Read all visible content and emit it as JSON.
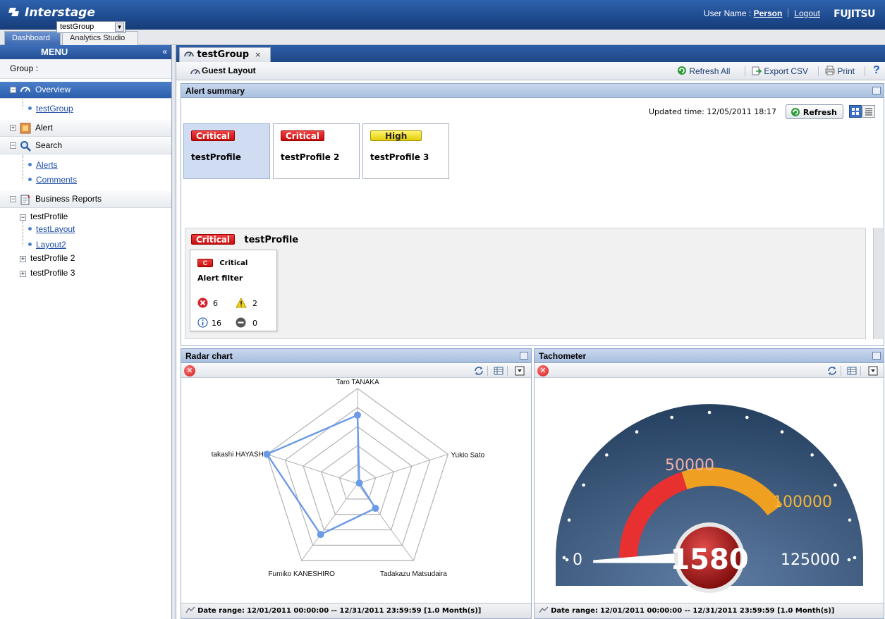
{
  "app": {
    "brand": "Interstage",
    "vendor": "FUJITSU",
    "user_label": "User Name :",
    "user_name": "Person",
    "logout": "Logout"
  },
  "app_tabs": [
    {
      "label": "Dashboard",
      "active": true
    },
    {
      "label": "Analytics Studio",
      "active": false
    }
  ],
  "menu": {
    "title": "MENU",
    "collapse_glyph": "«",
    "group_label": "Group :",
    "group_value": "testGroup",
    "sections": {
      "overview": {
        "label": "Overview",
        "items": [
          "testGroup"
        ]
      },
      "alert": {
        "label": "Alert"
      },
      "search": {
        "label": "Search",
        "items": [
          "Alerts",
          "Comments"
        ]
      },
      "reports": {
        "label": "Business Reports",
        "profiles": [
          {
            "name": "testProfile",
            "items": [
              "testLayout",
              "Layout2"
            ]
          },
          {
            "name": "testProfile 2"
          },
          {
            "name": "testProfile 3"
          }
        ]
      }
    }
  },
  "content": {
    "tab_label": "testGroup",
    "tab_close": "×",
    "layout_title": "Guest Layout",
    "toolbar": {
      "refresh_all": "Refresh All",
      "export_csv": "Export CSV",
      "print": "Print",
      "help": "?"
    }
  },
  "alert_summary": {
    "title": "Alert summary",
    "updated_label": "Updated time: 12/05/2011 18:17",
    "refresh": "Refresh",
    "cards": [
      {
        "severity": "Critical",
        "name": "testProfile"
      },
      {
        "severity": "Critical",
        "name": "testProfile 2"
      },
      {
        "severity": "High",
        "name": "testProfile 3"
      }
    ],
    "detail": {
      "severity": "Critical",
      "profile": "testProfile",
      "filter": {
        "badge": "C",
        "severity": "Critical",
        "name": "Alert filter",
        "counts": {
          "error": "6",
          "warning": "2",
          "info": "16",
          "stopped": "0"
        }
      }
    }
  },
  "radar": {
    "title": "Radar chart",
    "date_label": "Date range:",
    "date_range": "12/01/2011 00:00:00 -- 12/31/2011 23:59:59 [1.0 Month(s)]"
  },
  "tacho": {
    "title": "Tachometer",
    "date_label": "Date range:",
    "date_range": "12/01/2011 00:00:00 -- 12/31/2011 23:59:59 [1.0 Month(s)]",
    "labels": {
      "min": "0",
      "mid": "50000",
      "high": "100000",
      "max": "125000"
    },
    "value": "1580"
  },
  "chart_data": [
    {
      "type": "radar",
      "categories": [
        "Taro TANAKA",
        "Yukio Sato",
        "Tadakazu Matsudaira",
        "Fumiko KANESHIRO",
        "takashi HAYASHI"
      ],
      "series": [
        {
          "values": [
            0.72,
            0.02,
            0.32,
            0.66,
            1.0
          ]
        }
      ],
      "rings": 5,
      "color": "#6a9ae8"
    },
    {
      "type": "gauge",
      "value": 1580,
      "min": 0,
      "max": 125000,
      "bands": [
        {
          "from": 0,
          "to": 50000,
          "color": "#e83030"
        },
        {
          "from": 50000,
          "to": 100000,
          "color": "#f0a020"
        }
      ]
    }
  ]
}
